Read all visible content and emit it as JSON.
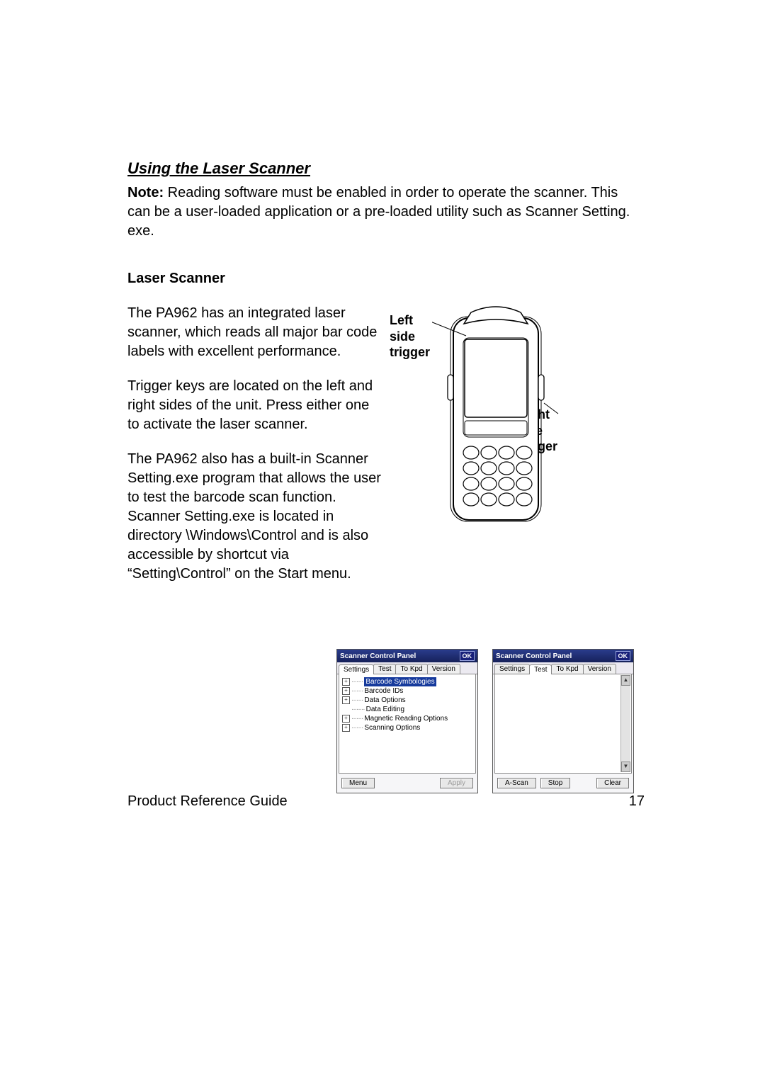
{
  "section_title": "Using the Laser Scanner",
  "note": {
    "label": "Note:",
    "text": "Reading software must be enabled in order to operate the scanner.  This can be a user-loaded application or a pre-loaded utility such as Scanner Setting. exe."
  },
  "sub_heading": "Laser Scanner",
  "paras": [
    "The PA962 has an integrated laser scanner, which reads all major bar code labels with excellent performance.",
    "Trigger keys are located on the left and right sides of the unit.  Press either one to activate the laser scanner.",
    "The PA962 also has a built-in Scanner Setting.exe program that allows the user to test the barcode scan function. Scanner Setting.exe is located in directory \\Windows\\Control and is also accessible by shortcut via “Setting\\Control” on the Start menu."
  ],
  "figure_labels": {
    "left": "Left\nside\ntrigger",
    "right": "Right\nside\ntrigger"
  },
  "windows": {
    "title": "Scanner Control Panel",
    "ok": "OK",
    "tabs": [
      "Settings",
      "Test",
      "To Kpd",
      "Version"
    ],
    "left_active_tab": "Settings",
    "right_active_tab": "Test",
    "tree": [
      {
        "expandable": true,
        "selected": true,
        "label": "Barcode Symbologies"
      },
      {
        "expandable": true,
        "selected": false,
        "label": "Barcode IDs"
      },
      {
        "expandable": true,
        "selected": false,
        "label": "Data Options"
      },
      {
        "expandable": false,
        "selected": false,
        "label": "Data Editing"
      },
      {
        "expandable": true,
        "selected": false,
        "label": "Magnetic Reading Options"
      },
      {
        "expandable": true,
        "selected": false,
        "label": "Scanning Options"
      }
    ],
    "left_buttons": {
      "menu": "Menu",
      "apply": "Apply"
    },
    "right_buttons": {
      "ascan": "A-Scan",
      "stop": "Stop",
      "clear": "Clear"
    }
  },
  "footer": {
    "left": "Product Reference Guide",
    "right": "17"
  }
}
